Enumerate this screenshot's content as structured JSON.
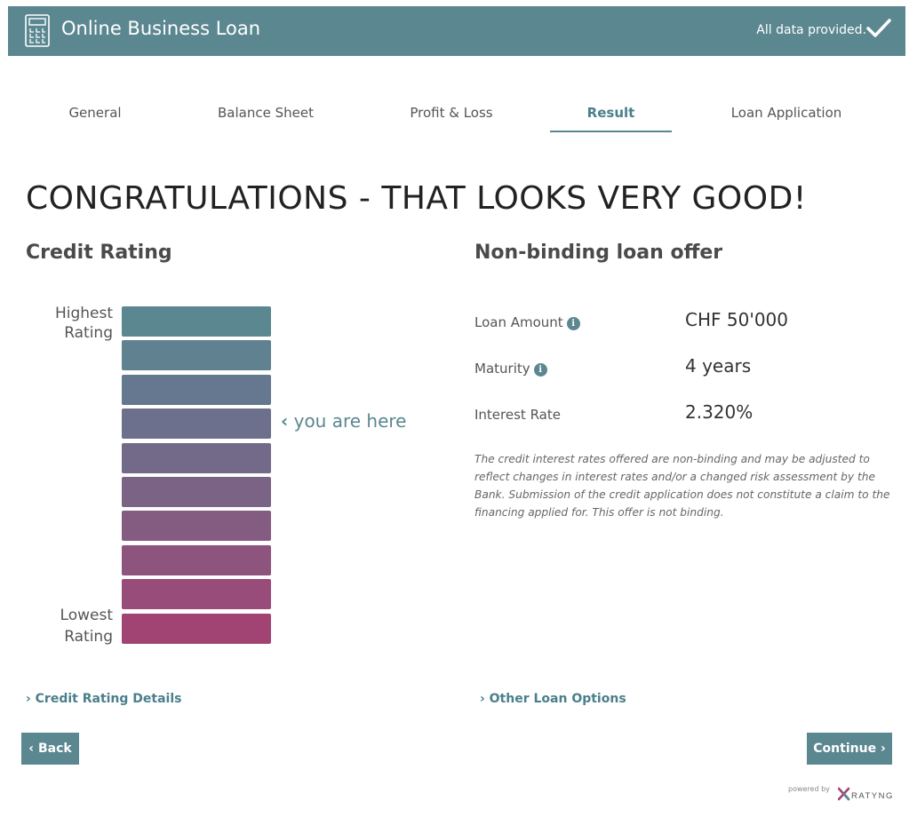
{
  "header": {
    "title": "Online Business Loan",
    "status": "All data provided.",
    "icon": "calculator-icon",
    "status_icon": "checkmark-icon",
    "bg_color": "#5b8791"
  },
  "tabs": [
    {
      "label": "General",
      "active": false
    },
    {
      "label": "Balance Sheet",
      "active": false
    },
    {
      "label": "Profit & Loss",
      "active": false
    },
    {
      "label": "Result",
      "active": true
    },
    {
      "label": "Loan Application",
      "active": false
    }
  ],
  "headline": "CONGRATULATIONS - THAT LOOKS VERY GOOD!",
  "credit_rating": {
    "title": "Credit Rating",
    "highest_label": "Highest Rating",
    "lowest_label": "Lowest Rating",
    "levels": 10,
    "current_level": 4,
    "marker_text": "you are here",
    "bar_colors": [
      "#5b8791",
      "#5f8190",
      "#66788f",
      "#6c708c",
      "#736a89",
      "#7b6386",
      "#845c82",
      "#8d547e",
      "#974c79",
      "#a14474"
    ],
    "details_link": "Credit Rating Details"
  },
  "offer": {
    "title": "Non-binding loan offer",
    "rows": [
      {
        "label": "Loan Amount",
        "value": "CHF 50'000",
        "info": true
      },
      {
        "label": "Maturity",
        "value": "4 years",
        "info": true
      },
      {
        "label": "Interest Rate",
        "value": "2.320%",
        "info": false
      }
    ],
    "disclaimer": "The credit interest rates offered are non-binding and may be adjusted to reflect changes in interest rates and/or a changed risk assessment by the Bank. Submission of the credit application does not constitute a claim to the financing applied for. This offer is not binding.",
    "other_link": "Other Loan Options"
  },
  "nav": {
    "back": "Back",
    "continue": "Continue"
  },
  "footer": {
    "powered_by": "powered by",
    "logo_text": "RATYNG"
  }
}
